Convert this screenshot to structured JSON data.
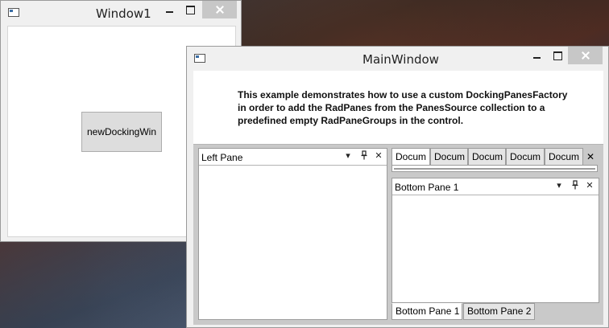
{
  "window1": {
    "title": "Window1",
    "button_label": "newDockingWin"
  },
  "main_window": {
    "title": "MainWindow",
    "description": "This example demonstrates how to use a custom DockingPanesFactory in order to add the RadPanes from the PanesSource collection to a predefined empty RadPaneGroups in the control.",
    "left_pane": {
      "title": "Left Pane",
      "icons": [
        "menu-dropdown-icon",
        "pin-icon",
        "close-icon"
      ]
    },
    "document_tabs": [
      "Docum",
      "Docum",
      "Docum",
      "Docum",
      "Docum"
    ],
    "active_document_index": 0,
    "bottom_pane": {
      "title": "Bottom Pane 1",
      "icons": [
        "menu-dropdown-icon",
        "pin-icon",
        "close-icon"
      ]
    },
    "bottom_tabs": [
      "Bottom Pane 1",
      "Bottom Pane 2"
    ],
    "active_bottom_tab_index": 0
  },
  "glyphs": {
    "dropdown": "▾",
    "pin": "🖈",
    "close": "✕"
  }
}
